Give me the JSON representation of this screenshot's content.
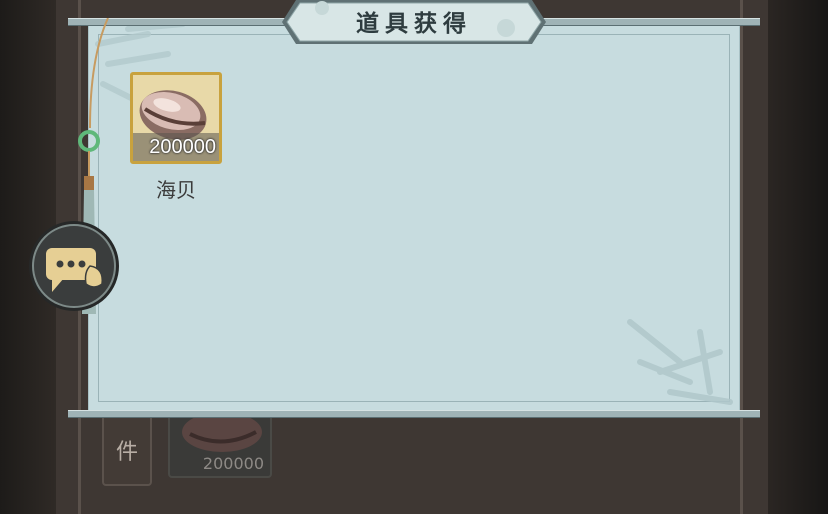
{
  "dialog": {
    "title": "道具获得"
  },
  "items": [
    {
      "name": "海贝",
      "quantity": "200000",
      "icon": "cowrie-shell-icon"
    }
  ],
  "background": {
    "card_label": "件",
    "item_quantity": "200000"
  },
  "chat_button": {
    "icon": "chat-bubble-icon"
  },
  "colors": {
    "paper": "#c7dcdf",
    "rod": "#9fb3b6",
    "slot_border": "#c8a23e",
    "title_text": "#2e3c3f"
  }
}
